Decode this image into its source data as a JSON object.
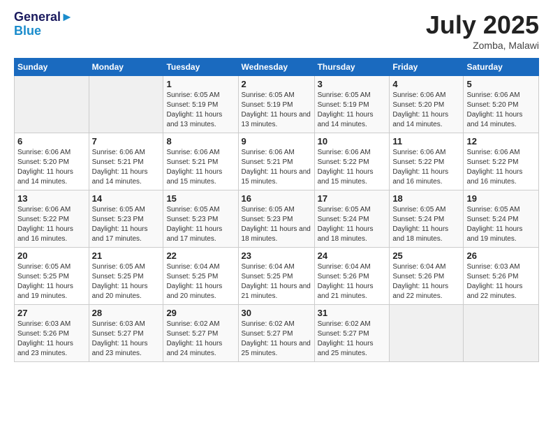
{
  "header": {
    "logo_line1": "General",
    "logo_line2": "Blue",
    "month": "July 2025",
    "location": "Zomba, Malawi"
  },
  "days_of_week": [
    "Sunday",
    "Monday",
    "Tuesday",
    "Wednesday",
    "Thursday",
    "Friday",
    "Saturday"
  ],
  "weeks": [
    [
      {
        "day": "",
        "detail": ""
      },
      {
        "day": "",
        "detail": ""
      },
      {
        "day": "1",
        "detail": "Sunrise: 6:05 AM\nSunset: 5:19 PM\nDaylight: 11 hours and 13 minutes."
      },
      {
        "day": "2",
        "detail": "Sunrise: 6:05 AM\nSunset: 5:19 PM\nDaylight: 11 hours and 13 minutes."
      },
      {
        "day": "3",
        "detail": "Sunrise: 6:05 AM\nSunset: 5:19 PM\nDaylight: 11 hours and 14 minutes."
      },
      {
        "day": "4",
        "detail": "Sunrise: 6:06 AM\nSunset: 5:20 PM\nDaylight: 11 hours and 14 minutes."
      },
      {
        "day": "5",
        "detail": "Sunrise: 6:06 AM\nSunset: 5:20 PM\nDaylight: 11 hours and 14 minutes."
      }
    ],
    [
      {
        "day": "6",
        "detail": "Sunrise: 6:06 AM\nSunset: 5:20 PM\nDaylight: 11 hours and 14 minutes."
      },
      {
        "day": "7",
        "detail": "Sunrise: 6:06 AM\nSunset: 5:21 PM\nDaylight: 11 hours and 14 minutes."
      },
      {
        "day": "8",
        "detail": "Sunrise: 6:06 AM\nSunset: 5:21 PM\nDaylight: 11 hours and 15 minutes."
      },
      {
        "day": "9",
        "detail": "Sunrise: 6:06 AM\nSunset: 5:21 PM\nDaylight: 11 hours and 15 minutes."
      },
      {
        "day": "10",
        "detail": "Sunrise: 6:06 AM\nSunset: 5:22 PM\nDaylight: 11 hours and 15 minutes."
      },
      {
        "day": "11",
        "detail": "Sunrise: 6:06 AM\nSunset: 5:22 PM\nDaylight: 11 hours and 16 minutes."
      },
      {
        "day": "12",
        "detail": "Sunrise: 6:06 AM\nSunset: 5:22 PM\nDaylight: 11 hours and 16 minutes."
      }
    ],
    [
      {
        "day": "13",
        "detail": "Sunrise: 6:06 AM\nSunset: 5:22 PM\nDaylight: 11 hours and 16 minutes."
      },
      {
        "day": "14",
        "detail": "Sunrise: 6:05 AM\nSunset: 5:23 PM\nDaylight: 11 hours and 17 minutes."
      },
      {
        "day": "15",
        "detail": "Sunrise: 6:05 AM\nSunset: 5:23 PM\nDaylight: 11 hours and 17 minutes."
      },
      {
        "day": "16",
        "detail": "Sunrise: 6:05 AM\nSunset: 5:23 PM\nDaylight: 11 hours and 18 minutes."
      },
      {
        "day": "17",
        "detail": "Sunrise: 6:05 AM\nSunset: 5:24 PM\nDaylight: 11 hours and 18 minutes."
      },
      {
        "day": "18",
        "detail": "Sunrise: 6:05 AM\nSunset: 5:24 PM\nDaylight: 11 hours and 18 minutes."
      },
      {
        "day": "19",
        "detail": "Sunrise: 6:05 AM\nSunset: 5:24 PM\nDaylight: 11 hours and 19 minutes."
      }
    ],
    [
      {
        "day": "20",
        "detail": "Sunrise: 6:05 AM\nSunset: 5:25 PM\nDaylight: 11 hours and 19 minutes."
      },
      {
        "day": "21",
        "detail": "Sunrise: 6:05 AM\nSunset: 5:25 PM\nDaylight: 11 hours and 20 minutes."
      },
      {
        "day": "22",
        "detail": "Sunrise: 6:04 AM\nSunset: 5:25 PM\nDaylight: 11 hours and 20 minutes."
      },
      {
        "day": "23",
        "detail": "Sunrise: 6:04 AM\nSunset: 5:25 PM\nDaylight: 11 hours and 21 minutes."
      },
      {
        "day": "24",
        "detail": "Sunrise: 6:04 AM\nSunset: 5:26 PM\nDaylight: 11 hours and 21 minutes."
      },
      {
        "day": "25",
        "detail": "Sunrise: 6:04 AM\nSunset: 5:26 PM\nDaylight: 11 hours and 22 minutes."
      },
      {
        "day": "26",
        "detail": "Sunrise: 6:03 AM\nSunset: 5:26 PM\nDaylight: 11 hours and 22 minutes."
      }
    ],
    [
      {
        "day": "27",
        "detail": "Sunrise: 6:03 AM\nSunset: 5:26 PM\nDaylight: 11 hours and 23 minutes."
      },
      {
        "day": "28",
        "detail": "Sunrise: 6:03 AM\nSunset: 5:27 PM\nDaylight: 11 hours and 23 minutes."
      },
      {
        "day": "29",
        "detail": "Sunrise: 6:02 AM\nSunset: 5:27 PM\nDaylight: 11 hours and 24 minutes."
      },
      {
        "day": "30",
        "detail": "Sunrise: 6:02 AM\nSunset: 5:27 PM\nDaylight: 11 hours and 25 minutes."
      },
      {
        "day": "31",
        "detail": "Sunrise: 6:02 AM\nSunset: 5:27 PM\nDaylight: 11 hours and 25 minutes."
      },
      {
        "day": "",
        "detail": ""
      },
      {
        "day": "",
        "detail": ""
      }
    ]
  ]
}
